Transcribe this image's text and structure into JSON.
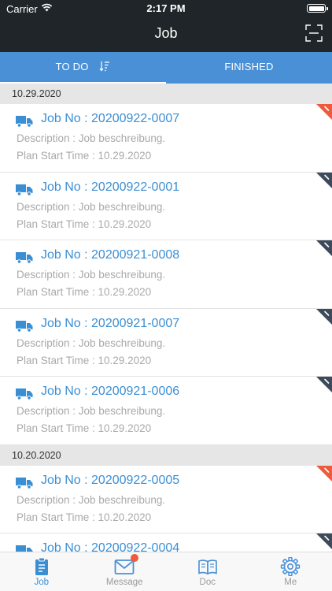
{
  "status_bar": {
    "carrier": "Carrier",
    "time": "2:17 PM"
  },
  "header": {
    "title": "Job",
    "scan_icon": "scan-icon"
  },
  "tabs": [
    {
      "label": "TO DO",
      "active": true
    },
    {
      "label": "FINISHED",
      "active": false
    }
  ],
  "colors": {
    "accent": "#4a90d6",
    "link": "#3a8fd4",
    "badge_red": "#ef5a3c",
    "badge_dark": "#3d4a5c",
    "header_bg": "#1f2528"
  },
  "sections": [
    {
      "date": "10.29.2020",
      "jobs": [
        {
          "job_no": "Job No : 20200922-0007",
          "description": "Description : Job beschreibung.",
          "plan": "Plan Start Time : 10.29.2020",
          "flag": "red"
        },
        {
          "job_no": "Job No : 20200922-0001",
          "description": "Description : Job beschreibung.",
          "plan": "Plan Start Time : 10.29.2020",
          "flag": "dark"
        },
        {
          "job_no": "Job No : 20200921-0008",
          "description": "Description : Job beschreibung.",
          "plan": "Plan Start Time : 10.29.2020",
          "flag": "dark"
        },
        {
          "job_no": "Job No : 20200921-0007",
          "description": "Description : Job beschreibung.",
          "plan": "Plan Start Time : 10.29.2020",
          "flag": "dark"
        },
        {
          "job_no": "Job No : 20200921-0006",
          "description": "Description : Job beschreibung.",
          "plan": "Plan Start Time : 10.29.2020",
          "flag": "dark"
        }
      ]
    },
    {
      "date": "10.20.2020",
      "jobs": [
        {
          "job_no": "Job No : 20200922-0005",
          "description": "Description : Job beschreibung.",
          "plan": "Plan Start Time : 10.20.2020",
          "flag": "red"
        },
        {
          "job_no": "Job No : 20200922-0004",
          "description": "",
          "plan": "",
          "flag": "dark"
        }
      ]
    }
  ],
  "tabbar": [
    {
      "label": "Job",
      "icon": "clipboard-icon",
      "active": true
    },
    {
      "label": "Message",
      "icon": "envelope-icon",
      "active": false,
      "badge": true
    },
    {
      "label": "Doc",
      "icon": "book-icon",
      "active": false
    },
    {
      "label": "Me",
      "icon": "gear-icon",
      "active": false
    }
  ]
}
